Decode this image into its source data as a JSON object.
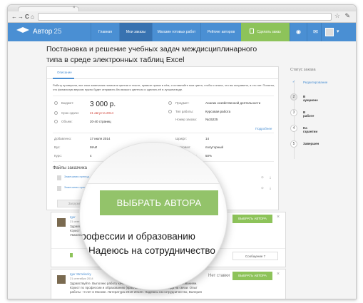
{
  "browser": {
    "tab_close": "×",
    "back": "←",
    "forward": "→",
    "reload": "C",
    "home": "⌂"
  },
  "nav": {
    "logo": "Автор",
    "logo_num": "25",
    "items": [
      "Главная",
      "Мои заказы",
      "Магазин готовых работ",
      "Рейтинг авторов"
    ],
    "order_button": "Сделать заказ",
    "accent": "#4a8fd3",
    "green": "#8dc35a"
  },
  "page": {
    "title": "Постановка и решение учебных задач междисциплинарного типа в среде электронных таблиц Excel"
  },
  "card": {
    "tab": "Описание",
    "description": "Работу проверили, все свои замечания написали цветом в тексте, правьте прямо в нём, и оставляйте мои цвета, чтобы я знала, что вы исправили, а что нет. Понятно, что финальную версию нужно будет отправить без всякого цветного и сделать её в лучшем виде.",
    "fields": {
      "budget_label": "Бюджет:",
      "budget": "3 000 р.",
      "deadline_label": "Срок сдачи:",
      "deadline": "21 августа 2014",
      "volume_label": "Объем:",
      "volume": "20-40 страниц",
      "subject_label": "Предмет:",
      "subject": "Анализ хозяйственной деятельности",
      "type_label": "Тип работы:",
      "type": "Курсовая работа",
      "number_label": "Номер заказа:",
      "number": "№15225",
      "more": "Подробнее",
      "added_label": "Добавлено:",
      "added": "17 июля 2014",
      "uni_label": "Вуз:",
      "uni": "МАИ",
      "course_label": "Курс:",
      "course": "4",
      "font_label": "Шрифт:",
      "font": "14",
      "interval_label": "Интервал:",
      "interval": "полуторный",
      "unique_label": "Уникальность:",
      "unique": "50%"
    },
    "files_head": "Файлы заказчика",
    "files": [
      "Замечания препод...",
      "Замечания препод..."
    ],
    "upload": "Загрузить"
  },
  "sidebar": {
    "head": "Статус заказа",
    "steps": [
      {
        "n": "✓",
        "label": "Редактирование"
      },
      {
        "n": "2",
        "label": "В аукционе"
      },
      {
        "n": "3",
        "label": "В работе"
      },
      {
        "n": "4",
        "label": "На гарантии"
      },
      {
        "n": "5",
        "label": "Завершен"
      }
    ]
  },
  "bids": [
    {
      "name": "Igor",
      "date": "21 сентября 2014",
      "text": "Здравствуйте. Выполню работу качественно, в срок и согласно Вашим требованиям. Юрист по профессии и образованию (красный диплом). Надеюсь на сотрудничество. С Уважением",
      "price": "Нет ставки",
      "button": "ВЫБРАТЬ АВТОРА",
      "close": "×",
      "message": "Сообщение",
      "message_count": "7"
    },
    {
      "name": "Igor Strzelecky",
      "date": "21 сентября 2014",
      "text": "Здравствуйте. Выполню работу качественно, в срок и согласно Вашим требованиям. Юрист по профессии и образованию (красный диплом). Почти всегда на связи. Опыт работы - 9 лет в Москве. Литература 2010-2013гг. Надеюсь на сотрудничество, Валерия",
      "price": "Нет ставки",
      "button": "ВЫБРАТЬ АВТОРА",
      "close": "×"
    }
  ],
  "magnifier": {
    "button": "ВЫБРАТЬ АВТОРА",
    "line1": "профессии и образованию",
    "line2": "Надеюсь на сотрудничество"
  }
}
